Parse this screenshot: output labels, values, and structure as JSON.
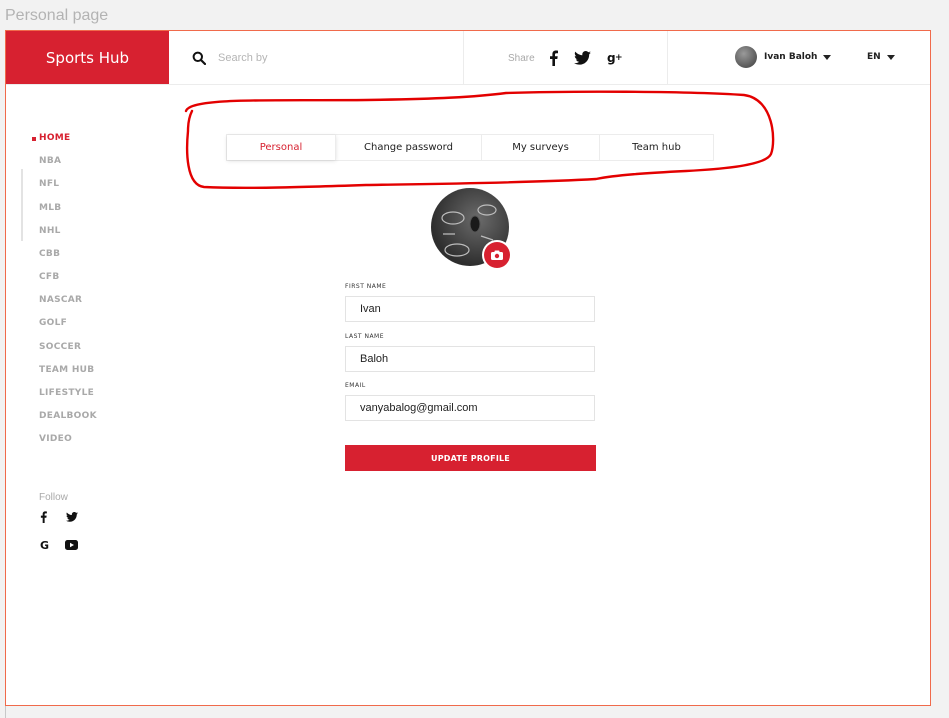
{
  "frame_label": "Personal page",
  "header": {
    "logo": "Sports Hub",
    "search_placeholder": "Search by",
    "share_label": "Share",
    "share_icons": [
      "facebook-icon",
      "twitter-icon",
      "google-plus-icon"
    ],
    "user_name": "Ivan Baloh",
    "language": "EN"
  },
  "sidebar": {
    "items": [
      "HOME",
      "NBA",
      "NFL",
      "MLB",
      "NHL",
      "CBB",
      "CFB",
      "NASCAR",
      "GOLF",
      "SOCCER",
      "TEAM HUB",
      "LIFESTYLE",
      "DEALBOOK",
      "VIDEO"
    ],
    "active": "HOME",
    "follow_label": "Follow",
    "follow_icons": [
      "facebook-icon",
      "twitter-icon",
      "google-icon",
      "youtube-icon"
    ]
  },
  "tabs": [
    "Personal",
    "Change password",
    "My surveys",
    "Team hub"
  ],
  "active_tab": "Personal",
  "form": {
    "first_name_label": "FIRST NAME",
    "first_name": "Ivan",
    "last_name_label": "LAST NAME",
    "last_name": "Baloh",
    "email_label": "EMAIL",
    "email": "vanyabalog@gmail.com",
    "submit": "UPDATE PROFILE"
  },
  "colors": {
    "accent": "#d72130",
    "annotation": "#e30000",
    "frame_border": "#f06a4b"
  }
}
